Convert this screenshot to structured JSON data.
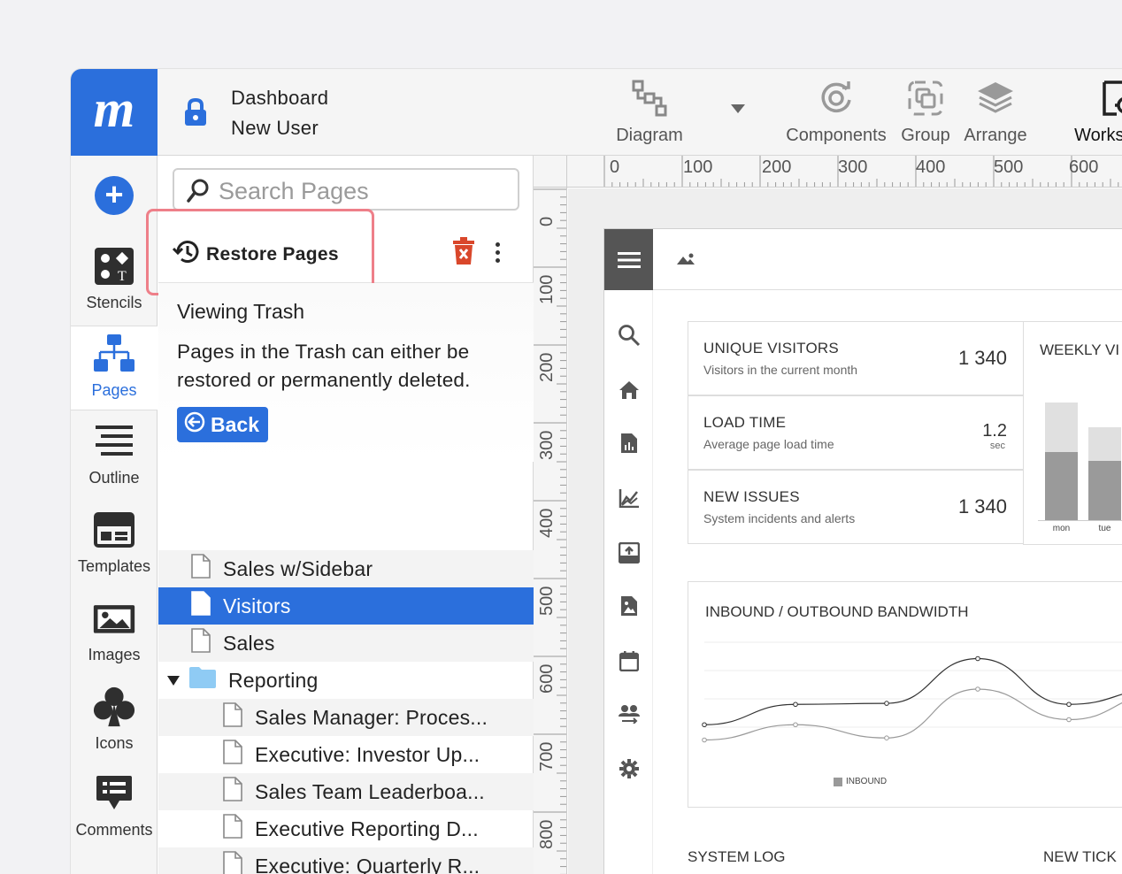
{
  "app": {
    "logo_text": "m",
    "document": {
      "title": "Dashboard",
      "subtitle": "New User"
    }
  },
  "rail": {
    "items": [
      {
        "label": "Stencils",
        "icon": "stencils-icon"
      },
      {
        "label": "Pages",
        "icon": "pages-icon",
        "active": true
      },
      {
        "label": "Outline",
        "icon": "outline-icon"
      },
      {
        "label": "Templates",
        "icon": "templates-icon"
      },
      {
        "label": "Images",
        "icon": "images-icon"
      },
      {
        "label": "Icons",
        "icon": "club-icon"
      },
      {
        "label": "Comments",
        "icon": "comment-icon"
      }
    ]
  },
  "toolbar": {
    "diagram": "Diagram",
    "components": "Components",
    "group": "Group",
    "arrange": "Arrange",
    "workspace": "Workspace"
  },
  "pages_panel": {
    "search_placeholder": "Search Pages",
    "restore_label": "Restore Pages",
    "trash_title": "Viewing Trash",
    "trash_text": "Pages in the Trash can either be restored or permanently deleted.",
    "back_label": "Back",
    "pages": [
      {
        "label": "Sales w/Sidebar",
        "level": 0,
        "type": "page"
      },
      {
        "label": "Visitors",
        "level": 0,
        "type": "page",
        "selected": true
      },
      {
        "label": "Sales",
        "level": 0,
        "type": "page"
      },
      {
        "label": "Reporting",
        "level": 0,
        "type": "folder",
        "expanded": true
      },
      {
        "label": "Sales Manager: Proces...",
        "level": 1,
        "type": "page"
      },
      {
        "label": "Executive: Investor Up...",
        "level": 1,
        "type": "page"
      },
      {
        "label": "Sales Team Leaderboa...",
        "level": 1,
        "type": "page"
      },
      {
        "label": "Executive Reporting D...",
        "level": 1,
        "type": "page"
      },
      {
        "label": "Executive: Quarterly R...",
        "level": 1,
        "type": "page"
      }
    ]
  },
  "rulers": {
    "top": [
      "0",
      "100",
      "200",
      "300",
      "400",
      "500",
      "600"
    ],
    "left": [
      "0",
      "100",
      "200",
      "300",
      "400",
      "500",
      "600",
      "700",
      "800"
    ]
  },
  "wireframe": {
    "stats": [
      {
        "title": "UNIQUE VISITORS",
        "subtitle": "Visitors in the current month",
        "value": "1 340"
      },
      {
        "title": "LOAD TIME",
        "subtitle": "Average page load time",
        "value": "1.2",
        "unit": "sec"
      },
      {
        "title": "NEW ISSUES",
        "subtitle": "System incidents and alerts",
        "value": "1 340"
      }
    ],
    "weekly_title": "WEEKLY VI",
    "bandwidth_title": "INBOUND / OUTBOUND BANDWIDTH",
    "system_log": "SYSTEM LOG",
    "new_tickets": "NEW TICK"
  },
  "chart_data": [
    {
      "type": "bar",
      "title": "WEEKLY VI",
      "categories": [
        "mon",
        "tue"
      ],
      "series": [
        {
          "values": [
            0.45,
            0.3
          ]
        },
        {
          "values": [
            0.55,
            0.48
          ]
        }
      ]
    },
    {
      "type": "line",
      "title": "INBOUND / OUTBOUND BANDWIDTH",
      "x": [
        0,
        1,
        2,
        3,
        4,
        5
      ],
      "series": [
        {
          "values": [
            0.25,
            0.45,
            0.46,
            0.9,
            0.45,
            0.6
          ]
        },
        {
          "name": "INBOUND",
          "values": [
            0.1,
            0.25,
            0.12,
            0.6,
            0.3,
            0.55
          ]
        }
      ],
      "legend": [
        "INBOUND"
      ]
    }
  ]
}
